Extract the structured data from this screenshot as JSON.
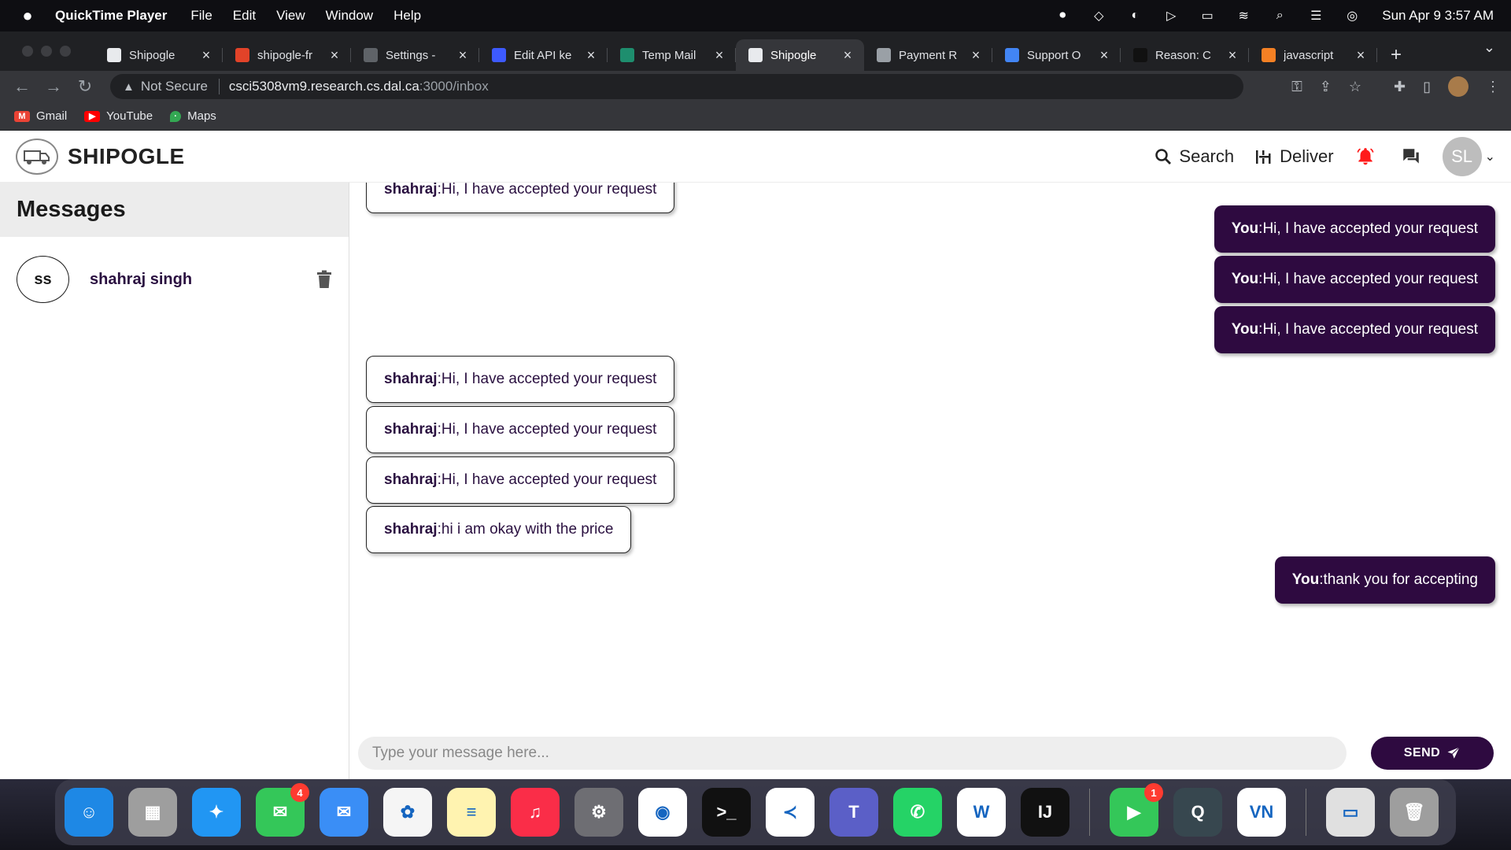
{
  "menubar": {
    "app_name": "QuickTime Player",
    "menus": [
      "File",
      "Edit",
      "View",
      "Window",
      "Help"
    ],
    "clock": "Sun Apr 9  3:57 AM"
  },
  "browser": {
    "tabs": [
      {
        "title": "Shipogle",
        "favicon_color": "#e8eaed",
        "favicon": "page-icon"
      },
      {
        "title": "shipogle-fr",
        "favicon_color": "#e24329",
        "favicon": "gitlab-icon"
      },
      {
        "title": "Settings - ",
        "favicon_color": "#5f6368",
        "favicon": "gear-icon"
      },
      {
        "title": "Edit API ke",
        "favicon_color": "#3d5afe",
        "favicon": "api-icon"
      },
      {
        "title": "Temp Mail",
        "favicon_color": "#1e8e6e",
        "favicon": "tempmail-icon"
      },
      {
        "title": "Shipogle",
        "favicon_color": "#e8eaed",
        "favicon": "page-icon",
        "active": true
      },
      {
        "title": "Payment R",
        "favicon_color": "#9aa0a6",
        "favicon": "globe-icon"
      },
      {
        "title": "Support O",
        "favicon_color": "#4285f4",
        "favicon": "google-icon"
      },
      {
        "title": "Reason: C",
        "favicon_color": "#111111",
        "favicon": "medium-icon"
      },
      {
        "title": "javascript",
        "favicon_color": "#f48024",
        "favicon": "stackoverflow-icon"
      }
    ],
    "security_label": "Not Secure",
    "url_host": "csci5308vm9.research.cs.dal.ca",
    "url_path": ":3000/inbox",
    "bookmarks": [
      {
        "label": "Gmail",
        "color": "#ea4335",
        "icon": "gmail-icon"
      },
      {
        "label": "YouTube",
        "color": "#ff0000",
        "icon": "youtube-icon"
      },
      {
        "label": "Maps",
        "color": "#34a853",
        "icon": "maps-icon"
      }
    ]
  },
  "app": {
    "brand": "SHIPOGLE",
    "nav": {
      "search_label": "Search",
      "deliver_label": "Deliver"
    },
    "avatar_initials": "SL",
    "accent_color": "#2e0a40",
    "bell_color": "#ff1a1a"
  },
  "sidebar": {
    "title": "Messages",
    "conversations": [
      {
        "initials": "ss",
        "name": "shahraj singh"
      }
    ]
  },
  "chat": {
    "messages": [
      {
        "sender": "shahraj",
        "text": "Hi, I have accepted your request",
        "dir": "in"
      },
      {
        "sender": "You",
        "text": "Hi, I have accepted your request",
        "dir": "out"
      },
      {
        "sender": "You",
        "text": "Hi, I have accepted your request",
        "dir": "out"
      },
      {
        "sender": "You",
        "text": "Hi, I have accepted your request",
        "dir": "out"
      },
      {
        "sender": "shahraj",
        "text": "Hi, I have accepted your request",
        "dir": "in"
      },
      {
        "sender": "shahraj",
        "text": "Hi, I have accepted your request",
        "dir": "in"
      },
      {
        "sender": "shahraj",
        "text": "Hi, I have accepted your request",
        "dir": "in"
      },
      {
        "sender": "shahraj",
        "text": "hi i am okay with the price",
        "dir": "in"
      },
      {
        "sender": "You",
        "text": "thank you for accepting",
        "dir": "out"
      }
    ],
    "input_placeholder": "Type your message here...",
    "send_label": "SEND"
  },
  "dock": {
    "apps": [
      {
        "name": "Finder",
        "color": "#1e88e5",
        "glyph": "☺"
      },
      {
        "name": "Launchpad",
        "color": "#9e9e9e",
        "glyph": "▦"
      },
      {
        "name": "Safari",
        "color": "#2196f3",
        "glyph": "✦"
      },
      {
        "name": "Messages",
        "color": "#34c759",
        "glyph": "✉",
        "badge": "4"
      },
      {
        "name": "Mail",
        "color": "#3a8ef6",
        "glyph": "✉"
      },
      {
        "name": "Photos",
        "color": "#f5f5f5",
        "glyph": "✿"
      },
      {
        "name": "Notes",
        "color": "#fff3b0",
        "glyph": "≡"
      },
      {
        "name": "Music",
        "color": "#fa2d48",
        "glyph": "♫"
      },
      {
        "name": "System Settings",
        "color": "#6e6e73",
        "glyph": "⚙"
      },
      {
        "name": "Chrome",
        "color": "#ffffff",
        "glyph": "◉"
      },
      {
        "name": "Terminal",
        "color": "#111111",
        "glyph": ">_"
      },
      {
        "name": "VS Code",
        "color": "#ffffff",
        "glyph": "≺"
      },
      {
        "name": "Teams",
        "color": "#5b5fc7",
        "glyph": "T"
      },
      {
        "name": "WhatsApp",
        "color": "#25d366",
        "glyph": "✆"
      },
      {
        "name": "Word",
        "color": "#ffffff",
        "glyph": "W"
      },
      {
        "name": "IntelliJ IDEA",
        "color": "#111111",
        "glyph": "IJ"
      },
      {
        "name": "FaceTime",
        "color": "#34c759",
        "glyph": "▶",
        "badge": "1"
      },
      {
        "name": "QuickTime",
        "color": "#37474f",
        "glyph": "Q"
      },
      {
        "name": "VN",
        "color": "#ffffff",
        "glyph": "VN"
      },
      {
        "name": "HTML File",
        "color": "#e0e0e0",
        "glyph": "▭"
      },
      {
        "name": "Trash",
        "color": "#9e9e9e",
        "glyph": "🗑"
      }
    ]
  }
}
